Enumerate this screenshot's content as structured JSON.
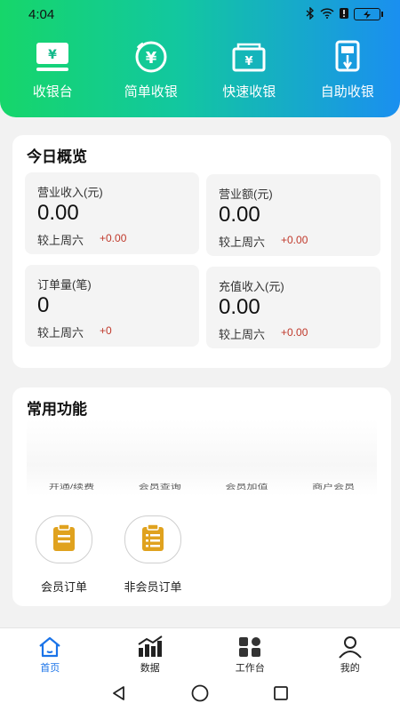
{
  "status_bar": {
    "time": "4:04",
    "icons": [
      "bluetooth-icon",
      "wifi-icon",
      "alert-icon",
      "battery-charging-icon"
    ]
  },
  "top_nav": [
    {
      "label": "收银台",
      "icon": "cashier-monitor-icon"
    },
    {
      "label": "简单收银",
      "icon": "yuan-coin-icon"
    },
    {
      "label": "快速收银",
      "icon": "yuan-wallet-icon"
    },
    {
      "label": "自助收银",
      "icon": "self-service-kiosk-icon"
    }
  ],
  "overview": {
    "title": "今日概览",
    "stats": [
      {
        "label": "营业收入(元)",
        "value": "0.00",
        "compare": "较上周六",
        "delta": "+0.00"
      },
      {
        "label": "营业额(元)",
        "value": "0.00",
        "compare": "较上周六",
        "delta": "+0.00"
      },
      {
        "label": "订单量(笔)",
        "value": "0",
        "compare": "较上周六",
        "delta": "+0"
      },
      {
        "label": "充值收入(元)",
        "value": "0.00",
        "compare": "较上周六",
        "delta": "+0.00"
      }
    ]
  },
  "functions": {
    "title": "常用功能",
    "faded_items": [
      "开通/续费",
      "会员查询",
      "会员加值",
      "商户会员"
    ],
    "items": [
      {
        "label": "会员订单",
        "icon": "clipboard-icon"
      },
      {
        "label": "非会员订单",
        "icon": "clipboard-list-icon"
      }
    ]
  },
  "bottom_nav": [
    {
      "label": "首页",
      "icon": "home-icon",
      "active": true
    },
    {
      "label": "数据",
      "icon": "chart-icon",
      "active": false
    },
    {
      "label": "工作台",
      "icon": "grid-icon",
      "active": false
    },
    {
      "label": "我的",
      "icon": "user-icon",
      "active": false
    }
  ],
  "colors": {
    "accent": "#1a73e8",
    "delta": "#c0392b",
    "gradient_start": "#16d66a",
    "gradient_end": "#1a8ff0",
    "clipboard": "#e0a21e"
  }
}
